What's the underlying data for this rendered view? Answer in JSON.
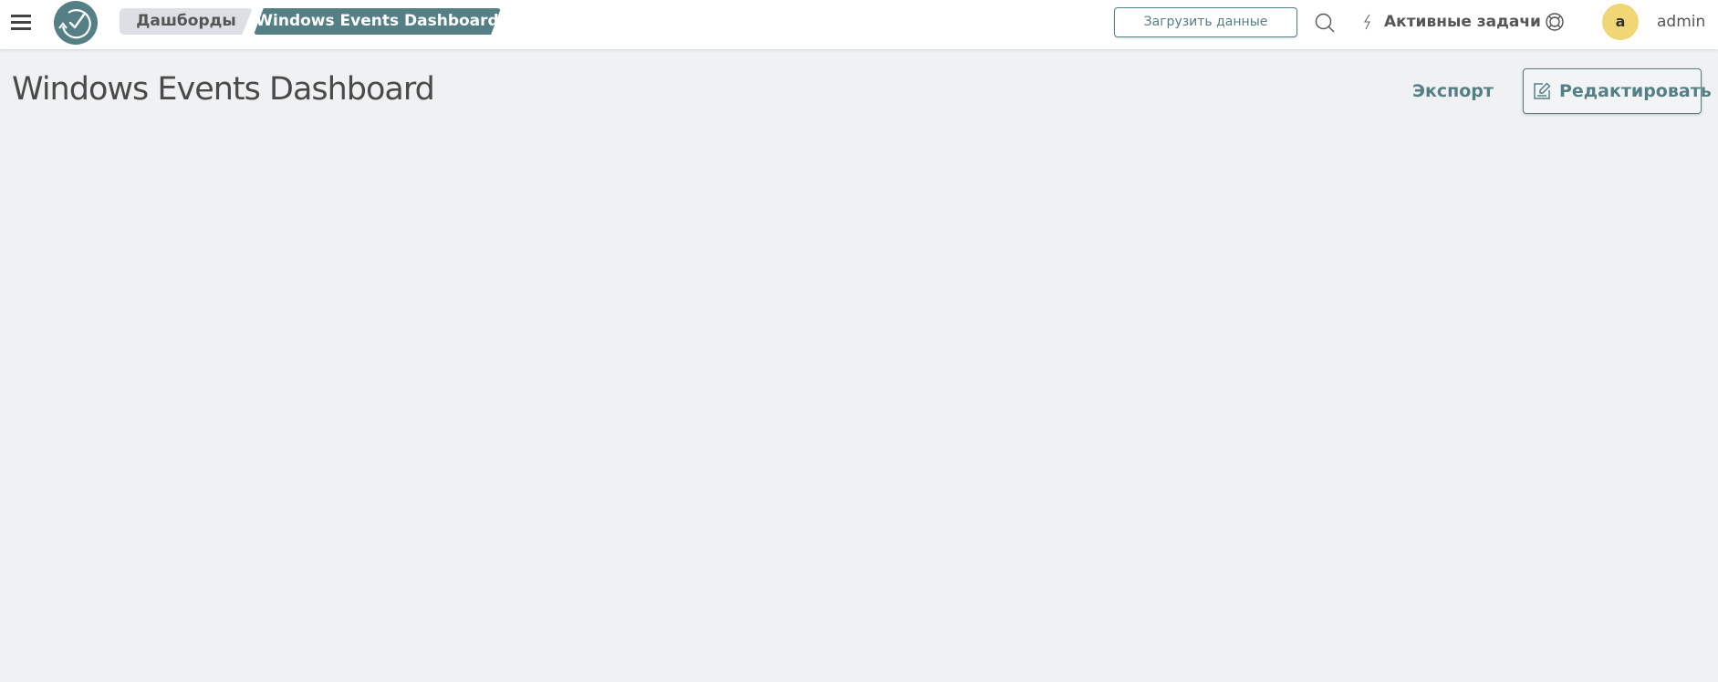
{
  "header": {
    "menu_icon": "hamburger-menu-icon",
    "logo_icon": "app-logo-icon",
    "breadcrumbs": [
      {
        "label": "Дашборды",
        "active": false
      },
      {
        "label": "Windows Events Dashboard",
        "active": true
      }
    ],
    "upload_button_label": "Загрузить данные",
    "search_icon": "search-icon",
    "active_tasks_icon": "bolt-icon",
    "active_tasks_label": "Активные задачи",
    "help_icon": "lifebuoy-icon",
    "user": {
      "avatar_letter": "a",
      "avatar_color": "#f0d675",
      "name": "admin"
    }
  },
  "page": {
    "title": "Windows Events Dashboard",
    "export_label": "Экспорт",
    "edit_label": "Редактировать",
    "edit_icon": "edit-icon"
  },
  "colors": {
    "accent": "#537f85",
    "background": "#f0f1f3",
    "breadcrumb_inactive": "#dcdfe3"
  }
}
